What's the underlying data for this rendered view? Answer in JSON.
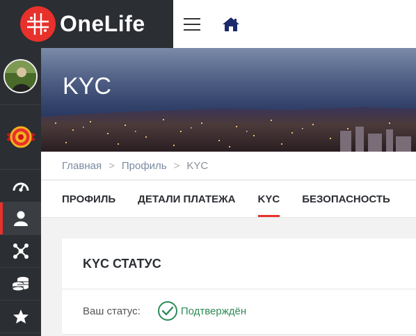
{
  "brand": {
    "name": "OneLife"
  },
  "hero": {
    "title": "KYC"
  },
  "breadcrumb": {
    "home": "Главная",
    "profile": "Профиль",
    "current": "KYC",
    "separator": ">"
  },
  "tabs": [
    {
      "label": "ПРОФИЛЬ",
      "active": false
    },
    {
      "label": "ДЕТАЛИ ПЛАТЕЖА",
      "active": false
    },
    {
      "label": "KYC",
      "active": true
    },
    {
      "label": "БЕЗОПАСНОСТЬ",
      "active": false
    }
  ],
  "card": {
    "title": "KYC СТАТУС",
    "status_label": "Ваш статус:",
    "status_value": "Подтверждён"
  },
  "sidebar": {
    "items": [
      {
        "icon": "dashboard-icon",
        "active": false
      },
      {
        "icon": "user-icon",
        "active": true
      },
      {
        "icon": "network-icon",
        "active": false
      },
      {
        "icon": "coins-icon",
        "active": false
      },
      {
        "icon": "star-icon",
        "active": false
      }
    ]
  },
  "colors": {
    "accent": "#e8312c",
    "sidebar": "#2b2e33",
    "success": "#2e8b57",
    "nav_blue": "#1c2a6b"
  }
}
